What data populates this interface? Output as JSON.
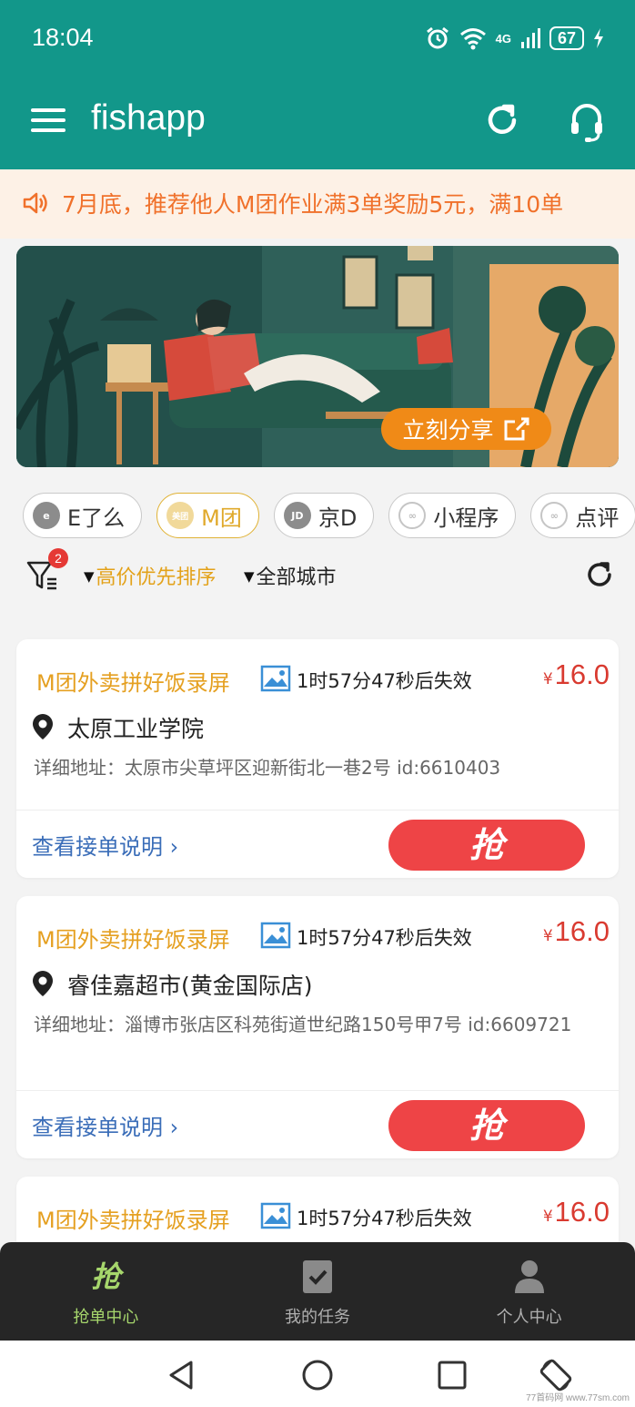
{
  "status_bar": {
    "time": "18:04",
    "network": "4G",
    "battery": "67",
    "icons": [
      "alarm-icon",
      "wifi-icon",
      "signal-icon",
      "battery-icon",
      "charging-icon"
    ]
  },
  "app_bar": {
    "title": "fishapp",
    "actions": [
      "refresh-icon",
      "headset-icon"
    ]
  },
  "notice": {
    "text": "7月底，推荐他人M团作业满3单奖励5元，满10单"
  },
  "banner": {
    "share_label": "立刻分享"
  },
  "tabs": [
    {
      "label": "E了么",
      "icon_text": "e",
      "active": false
    },
    {
      "label": "M团",
      "icon_text": "美团",
      "active": true
    },
    {
      "label": "京D",
      "icon_text": "JD",
      "active": false
    },
    {
      "label": "小程序",
      "icon_text": "",
      "active": false
    },
    {
      "label": "点评",
      "icon_text": "",
      "active": false
    }
  ],
  "filters": {
    "badge_count": "2",
    "sort_label": "高价优先排序",
    "city_label": "全部城市"
  },
  "orders": [
    {
      "title": "M团外卖拼好饭录屏",
      "expire": "1时57分47秒后失效",
      "currency": "¥",
      "price": "16.0",
      "name": "太原工业学院",
      "address": "详细地址：太原市尖草坪区迎新街北一巷2号   id:6610403",
      "link": "查看接单说明",
      "grab_label": "抢"
    },
    {
      "title": "M团外卖拼好饭录屏",
      "expire": "1时57分47秒后失效",
      "currency": "¥",
      "price": "16.0",
      "name": "睿佳嘉超市(黄金国际店)",
      "address": "详细地址：淄博市张店区科苑街道世纪路150号甲7号 id:6609721",
      "link": "查看接单说明",
      "grab_label": "抢"
    },
    {
      "title": "M团外卖拼好饭录屏",
      "expire": "1时57分47秒后失效",
      "currency": "¥",
      "price": "16.0"
    }
  ],
  "bottom_nav": [
    {
      "label": "抢单中心",
      "glyph": "抢",
      "active": true
    },
    {
      "label": "我的任务",
      "icon": "task-check-icon",
      "active": false
    },
    {
      "label": "个人中心",
      "icon": "person-icon",
      "active": false
    }
  ],
  "system_nav": [
    "back-icon",
    "home-icon",
    "recents-icon",
    "rotate-icon"
  ],
  "watermark": "77首码网 www.77sm.com",
  "colors": {
    "primary": "#12978a",
    "accent_orange": "#e5a021",
    "price_red": "#d93a30",
    "grab_red": "#ee4446",
    "notice_bg": "#fdf1e6",
    "notice_text": "#f0712b",
    "nav_bg": "#262626",
    "nav_active": "#a6d66c",
    "link_blue": "#3a6db8"
  }
}
